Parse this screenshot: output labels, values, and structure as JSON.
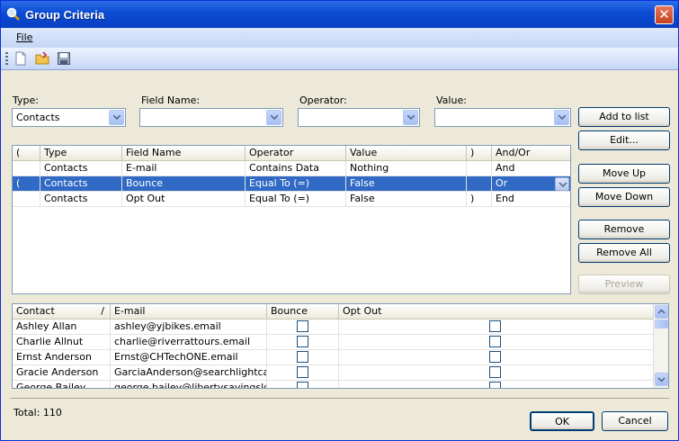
{
  "window": {
    "title": "Group Criteria",
    "close_label": "✕"
  },
  "menu": {
    "file": "File"
  },
  "toolbar": {
    "icons": [
      "new-document-icon",
      "open-folder-icon",
      "save-disk-icon"
    ]
  },
  "filters": {
    "type": {
      "label": "Type:",
      "value": "Contacts"
    },
    "field_name": {
      "label": "Field Name:",
      "value": ""
    },
    "operator": {
      "label": "Operator:",
      "value": ""
    },
    "value": {
      "label": "Value:",
      "value": ""
    }
  },
  "criteria": {
    "headers": [
      "(",
      "Type",
      "Field Name",
      "Operator",
      "Value",
      ")",
      "And/Or"
    ],
    "rows": [
      {
        "open": "",
        "type": "Contacts",
        "field": "E-mail",
        "operator": "Contains Data",
        "value": "Nothing",
        "close": "",
        "andor": "And",
        "selected": false
      },
      {
        "open": "(",
        "type": "Contacts",
        "field": "Bounce",
        "operator": "Equal To (=)",
        "value": "False",
        "close": "",
        "andor": "Or",
        "selected": true
      },
      {
        "open": "",
        "type": "Contacts",
        "field": "Opt Out",
        "operator": "Equal To (=)",
        "value": "False",
        "close": ")",
        "andor": "End",
        "selected": false
      }
    ]
  },
  "buttons": {
    "add_to_list": "Add to list",
    "edit": "Edit...",
    "move_up": "Move Up",
    "move_down": "Move Down",
    "remove": "Remove",
    "remove_all": "Remove All",
    "preview": "Preview",
    "ok": "OK",
    "cancel": "Cancel"
  },
  "results": {
    "headers": [
      "Contact",
      "E-mail",
      "Bounce",
      "Opt Out"
    ],
    "sort_indicator": "/",
    "rows": [
      {
        "contact": "Ashley Allan",
        "email": "ashley@yjbikes.email",
        "bounce": false,
        "optout": false
      },
      {
        "contact": "Charlie Allnut",
        "email": "charlie@riverrattours.email",
        "bounce": false,
        "optout": false
      },
      {
        "contact": "Ernst Anderson",
        "email": "Ernst@CHTechONE.email",
        "bounce": false,
        "optout": false
      },
      {
        "contact": "Gracie Anderson",
        "email": "GarciaAnderson@searchlightcasting.email",
        "bounce": false,
        "optout": false
      },
      {
        "contact": "George Bailey",
        "email": "george.bailey@libertysavingsloan.email",
        "bounce": false,
        "optout": false
      }
    ]
  },
  "footer": {
    "total": "Total: 110"
  },
  "colors": {
    "titlebar": "#0a4bd3",
    "selection": "#316ac5",
    "dialog": "#ece9d8"
  }
}
